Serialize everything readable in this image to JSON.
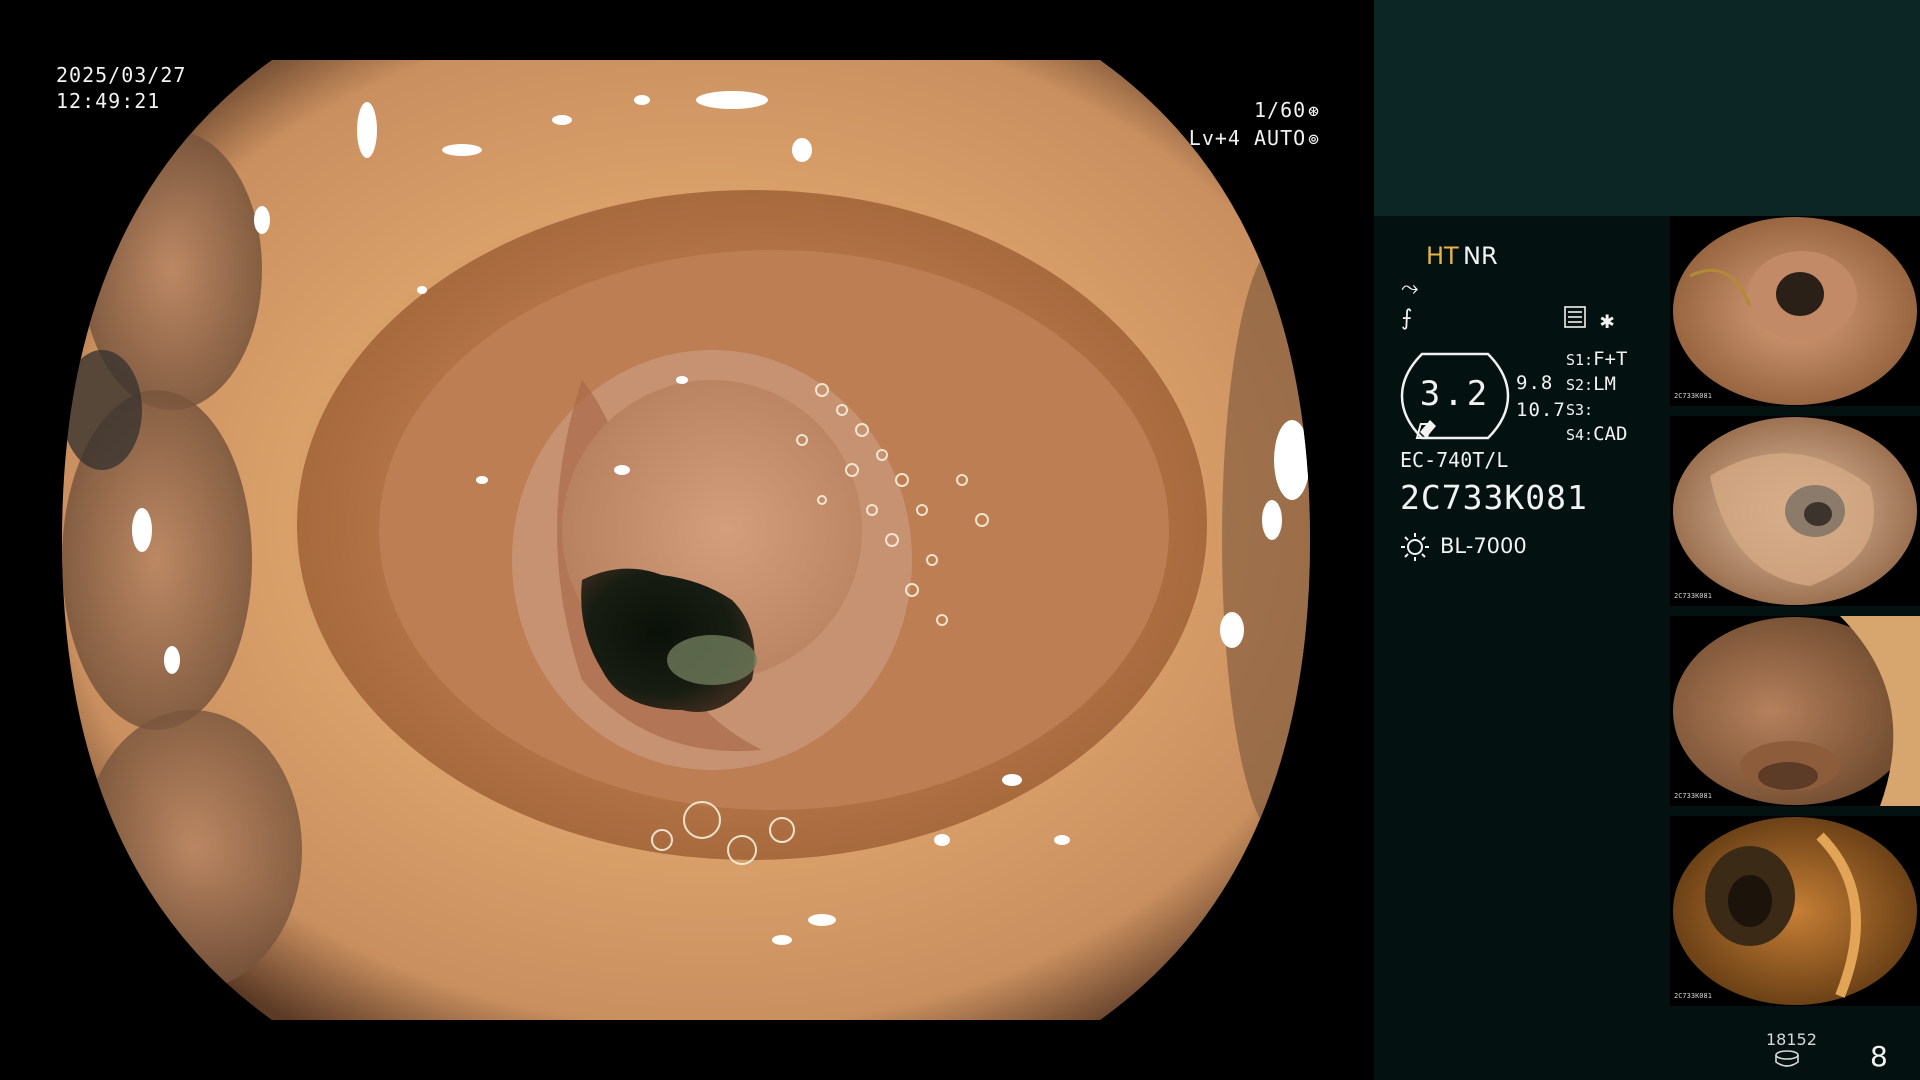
{
  "overlay": {
    "date": "2025/03/27",
    "time": "12:49:21",
    "shutter": "1/60",
    "level": "Lv+4 AUTO"
  },
  "info": {
    "mode_ht": "HT",
    "mode_nr": "NR",
    "zoom_value": "3.2",
    "zoom_a": "9.8",
    "zoom_b": "10.7",
    "switches": [
      {
        "key": "S1:",
        "value": "F+T"
      },
      {
        "key": "S2:",
        "value": "LM"
      },
      {
        "key": "S3:",
        "value": ""
      },
      {
        "key": "S4:",
        "value": "CAD"
      }
    ],
    "scope_model": "EC-740T/L",
    "scope_serial": "2C733K081",
    "light_source": "BL-7000",
    "image_counter": "18152",
    "page_number": "8"
  },
  "thumbnails": [
    {
      "label": "2C733K081"
    },
    {
      "label": "2C733K081"
    },
    {
      "label": "2C733K081"
    },
    {
      "label": "2C733K081"
    }
  ],
  "colors": {
    "header_panel": "#0c2626",
    "info_panel": "#031110",
    "ht_accent": "#e8b348",
    "overlay_text": "#f2f2f2"
  },
  "icons": {
    "shutter": "aperture-icon",
    "level": "iris-icon",
    "enhance": "enhancement-curve-icon",
    "filter": "filter-icon",
    "list": "list-settings-icon",
    "star": "asterisk-icon",
    "lamp": "light-source-icon",
    "disk": "storage-icon"
  }
}
